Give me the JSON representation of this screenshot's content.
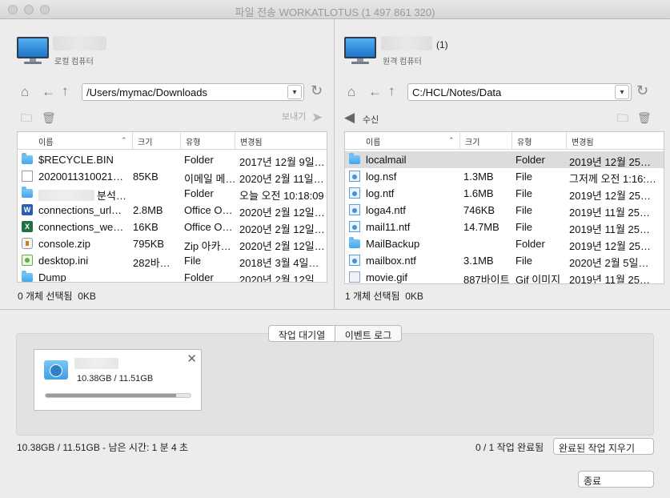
{
  "window": {
    "title": "파일 전송 WORKATLOTUS (1 497 861 320)"
  },
  "left": {
    "host_type": "로컬 컴퓨터",
    "path": "/Users/mymac/Downloads",
    "send_label": "보내기",
    "columns": [
      "이름",
      "크기",
      "유형",
      "변경됨"
    ],
    "rows": [
      {
        "icon": "folder",
        "name": "$RECYCLE.BIN",
        "size": "",
        "type": "Folder",
        "modified": "2017년 12월 9일…"
      },
      {
        "icon": "doc",
        "name": "2020011310021…",
        "size": "85KB",
        "type": "이메일 메…",
        "modified": "2020년 2월 11일…"
      },
      {
        "icon": "folder",
        "name": "분석…",
        "size": "",
        "type": "Folder",
        "modified": "오늘 오전 10:18:09",
        "blurred": true
      },
      {
        "icon": "word",
        "name": "connections_url…",
        "size": "2.8MB",
        "type": "Office O…",
        "modified": "2020년 2월 12일…"
      },
      {
        "icon": "excel",
        "name": "connections_we…",
        "size": "16KB",
        "type": "Office O…",
        "modified": "2020년 2월 12일…"
      },
      {
        "icon": "zip",
        "name": "console.zip",
        "size": "795KB",
        "type": "Zip 아카…",
        "modified": "2020년 2월 12일…"
      },
      {
        "icon": "ini",
        "name": "desktop.ini",
        "size": "282바…",
        "type": "File",
        "modified": "2018년 3월 4일…"
      },
      {
        "icon": "folder",
        "name": "Dump",
        "size": "",
        "type": "Folder",
        "modified": "2020년 2월 12일…"
      }
    ],
    "selection_status": "0 개체 선택됨",
    "selection_size": "0KB"
  },
  "right": {
    "host_type": "원격 컴퓨터",
    "count": "(1)",
    "path": "C:/HCL/Notes/Data",
    "receive_label": "수신",
    "columns": [
      "이름",
      "크기",
      "유형",
      "변경됨"
    ],
    "rows": [
      {
        "icon": "folder",
        "name": "localmail",
        "size": "",
        "type": "Folder",
        "modified": "2019년 12월 25…",
        "selected": true
      },
      {
        "icon": "docblue",
        "name": "log.nsf",
        "size": "1.3MB",
        "type": "File",
        "modified": "그저께 오전 1:16:…"
      },
      {
        "icon": "docblue",
        "name": "log.ntf",
        "size": "1.6MB",
        "type": "File",
        "modified": "2019년 12월 25…"
      },
      {
        "icon": "docblue",
        "name": "loga4.ntf",
        "size": "746KB",
        "type": "File",
        "modified": "2019년 11월 25…"
      },
      {
        "icon": "docblue",
        "name": "mail11.ntf",
        "size": "14.7MB",
        "type": "File",
        "modified": "2019년 11월 25…"
      },
      {
        "icon": "folder",
        "name": "MailBackup",
        "size": "",
        "type": "Folder",
        "modified": "2019년 12월 25…"
      },
      {
        "icon": "docblue",
        "name": "mailbox.ntf",
        "size": "3.1MB",
        "type": "File",
        "modified": "2020년 2월 5일…"
      },
      {
        "icon": "gif",
        "name": "movie.gif",
        "size": "887바이트",
        "type": "Gif 이미지",
        "modified": "2019년 11월 25…"
      }
    ],
    "selection_status": "1 개체 선택됨",
    "selection_size": "0KB"
  },
  "bottom": {
    "tabs": [
      "작업 대기열",
      "이벤트 로그"
    ],
    "active_tab": 0,
    "job": {
      "progress_text": "10.38GB / 11.51GB",
      "progress": 0.902
    },
    "total_status": "10.38GB / 11.51GB - 남은 시간: 1 분 4 초",
    "done_count": "0 / 1 작업 완료됨",
    "clear_button": "완료된 작업 지우기",
    "close_button": "종료"
  }
}
